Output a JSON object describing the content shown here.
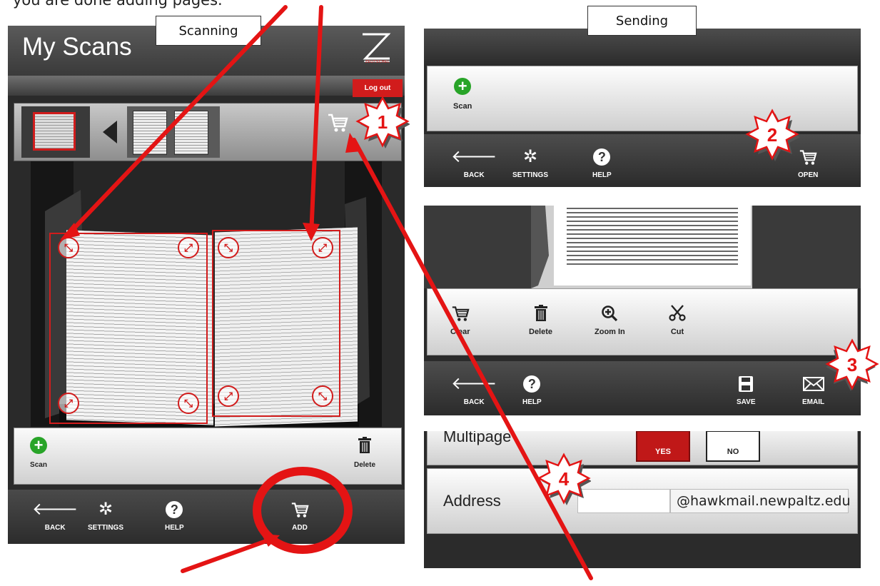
{
  "caption_top": "you are done adding pages.",
  "callouts": {
    "scanning": "Scanning",
    "sending": "Sending"
  },
  "left": {
    "title": "My Scans",
    "logo_text": "ZEUTSCHEL",
    "logout": "Log out",
    "actions": {
      "scan": "Scan",
      "delete": "Delete"
    },
    "nav": {
      "back": "BACK",
      "settings": "SETTINGS",
      "help": "HELP",
      "add": "ADD"
    }
  },
  "right_top": {
    "scan": "Scan",
    "nav": {
      "back": "BACK",
      "settings": "SETTINGS",
      "help": "HELP",
      "open": "OPEN"
    }
  },
  "right_mid": {
    "tools": {
      "clear": "Clear",
      "delete": "Delete",
      "zoom_in": "Zoom In",
      "cut": "Cut"
    },
    "nav": {
      "back": "BACK",
      "help": "HELP",
      "save": "SAVE",
      "email": "EMAIL"
    }
  },
  "right_bottom": {
    "multipage_label": "Multipage",
    "yes": "YES",
    "no": "NO",
    "address_label": "Address",
    "address_value": "",
    "domain": "@hawkmail.newpaltz.edu"
  },
  "badges": [
    "1",
    "2",
    "3",
    "4"
  ],
  "colors": {
    "accent_red": "#d11c1c",
    "plus_green": "#28a428",
    "dark_bar": "#2b2b2b"
  },
  "icons": [
    "cart-icon",
    "back-arrow-icon",
    "gear-icon",
    "help-icon",
    "trash-icon",
    "zoom-in-icon",
    "scissors-icon",
    "save-icon",
    "email-icon",
    "plus-icon"
  ]
}
